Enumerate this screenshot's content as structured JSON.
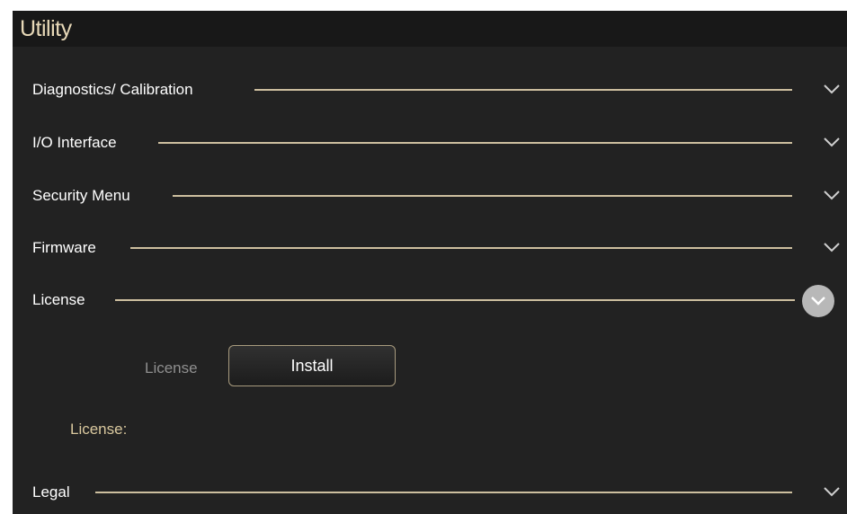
{
  "window": {
    "title": "Utility"
  },
  "sections": [
    {
      "label": "Diagnostics/ Calibration",
      "expanded": false,
      "icon": "chevron-down-icon"
    },
    {
      "label": "I/O Interface",
      "expanded": false,
      "icon": "chevron-down-icon"
    },
    {
      "label": "Security Menu",
      "expanded": false,
      "icon": "chevron-down-icon"
    },
    {
      "label": "Firmware",
      "expanded": false,
      "icon": "chevron-down-icon"
    },
    {
      "label": "License",
      "expanded": true,
      "icon": "chevron-down-circle-icon"
    },
    {
      "label": "Legal",
      "expanded": false,
      "icon": "chevron-down-icon"
    }
  ],
  "license_panel": {
    "row_label": "License",
    "install_label": "Install",
    "info_label": "License:"
  },
  "colors": {
    "background": "#222222",
    "title_bar": "#181818",
    "title_text": "#e8d9b8",
    "accent_line": "#cdbf9f",
    "muted_text": "#8f8f8f",
    "license_text": "#d9c89e"
  }
}
